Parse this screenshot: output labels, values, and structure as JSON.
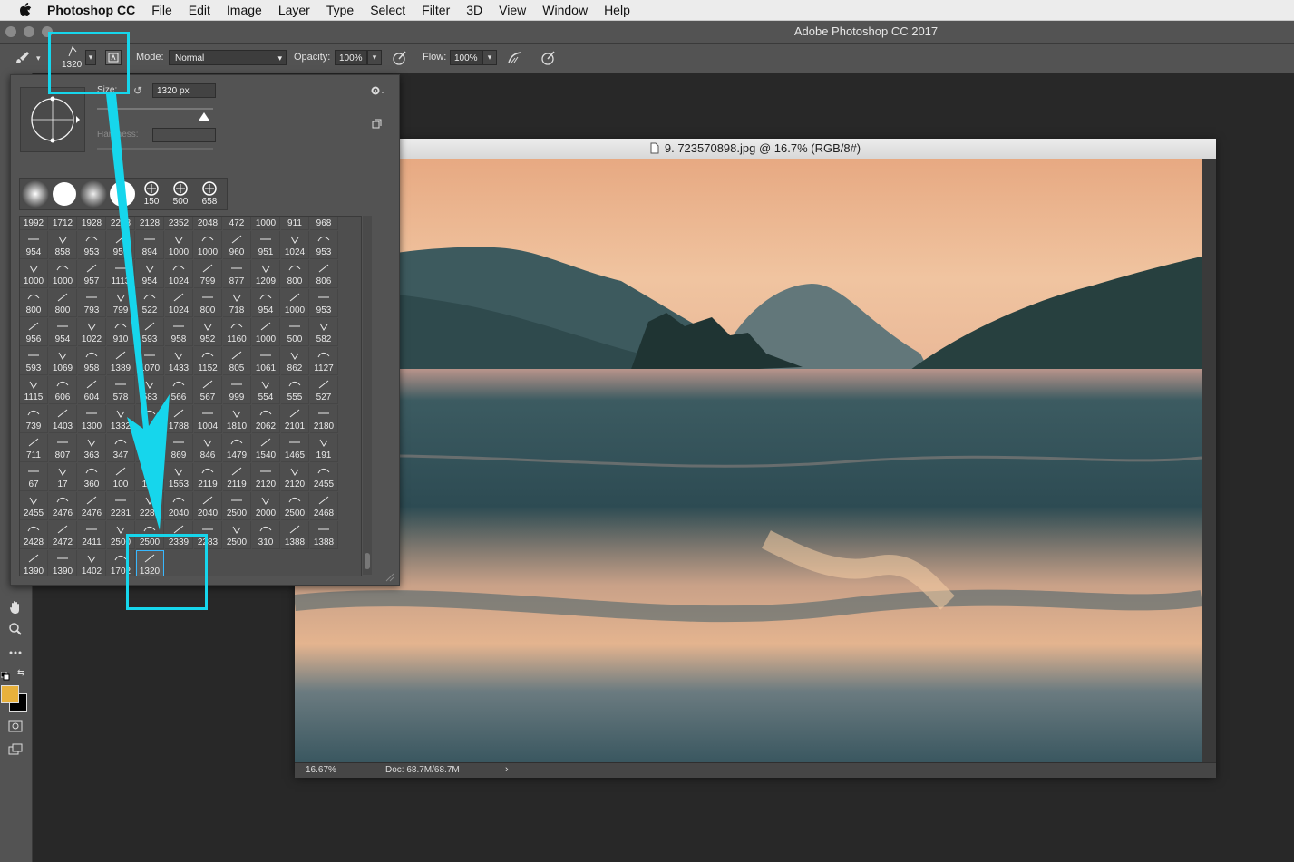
{
  "menubar": {
    "app": "Photoshop CC",
    "items": [
      "File",
      "Edit",
      "Image",
      "Layer",
      "Type",
      "Select",
      "Filter",
      "3D",
      "View",
      "Window",
      "Help"
    ]
  },
  "window": {
    "title": "Adobe Photoshop CC 2017"
  },
  "options": {
    "brush_size": "1320",
    "mode_label": "Mode:",
    "mode_value": "Normal",
    "opacity_label": "Opacity:",
    "opacity_value": "100%",
    "flow_label": "Flow:",
    "flow_value": "100%"
  },
  "picker": {
    "size_label": "Size:",
    "size_value": "1320 px",
    "hardness_label": "Hardness:",
    "recent": [
      "",
      "",
      "",
      "",
      "150",
      "500",
      "658"
    ],
    "rows": [
      [
        "1992",
        "1712",
        "1928",
        "2208",
        "2128",
        "2352",
        "2048",
        "472",
        "1000",
        "911",
        "968"
      ],
      [
        "954",
        "858",
        "953",
        "959",
        "894",
        "1000",
        "1000",
        "960",
        "951",
        "1024",
        "953"
      ],
      [
        "1000",
        "1000",
        "957",
        "1113",
        "954",
        "1024",
        "799",
        "877",
        "1209",
        "800",
        "806"
      ],
      [
        "800",
        "800",
        "793",
        "799",
        "522",
        "1024",
        "800",
        "718",
        "954",
        "1000",
        "953"
      ],
      [
        "956",
        "954",
        "1022",
        "910",
        "593",
        "958",
        "952",
        "1160",
        "1000",
        "500",
        "582"
      ],
      [
        "593",
        "1069",
        "958",
        "1389",
        "1070",
        "1433",
        "1152",
        "805",
        "1061",
        "862",
        "1127"
      ],
      [
        "1115",
        "606",
        "604",
        "578",
        "583",
        "566",
        "567",
        "999",
        "554",
        "555",
        "527"
      ],
      [
        "739",
        "1403",
        "1300",
        "1332",
        "",
        "1788",
        "1004",
        "1810",
        "2062",
        "2101",
        "2180"
      ],
      [
        "711",
        "807",
        "363",
        "347",
        "",
        "869",
        "846",
        "1479",
        "1540",
        "1465",
        "191"
      ],
      [
        "67",
        "17",
        "360",
        "100",
        "123",
        "1553",
        "2119",
        "2119",
        "2120",
        "2120",
        "2455"
      ],
      [
        "2455",
        "2476",
        "2476",
        "2281",
        "2281",
        "2040",
        "2040",
        "2500",
        "2000",
        "2500",
        "2468"
      ],
      [
        "2428",
        "2472",
        "2411",
        "2500",
        "2500",
        "2339",
        "2283",
        "2500",
        "310",
        "1388",
        "1388"
      ],
      [
        "1390",
        "1390",
        "1402",
        "1702",
        "1320"
      ]
    ]
  },
  "document": {
    "tab_title": "9. 723570898.jpg @ 16.7% (RGB/8#)",
    "zoom": "16.67%",
    "doc_info": "Doc: 68.7M/68.7M"
  },
  "colors": {
    "highlight": "#16d6ec",
    "foreground": "#e8b13c",
    "background": "#000000",
    "ui_panel": "#535353"
  }
}
